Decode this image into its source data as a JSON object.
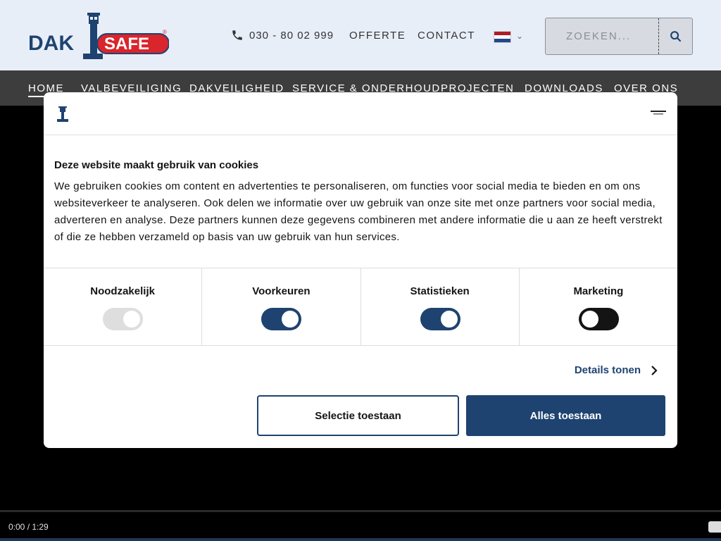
{
  "header": {
    "logo_text_left": "DAK",
    "logo_text_right": "SAFE",
    "logo_mark": "®",
    "phone": "030 - 80 02 999",
    "links": [
      "OFFERTE",
      "CONTACT"
    ],
    "search_placeholder": "ZOEKEN..."
  },
  "nav": {
    "items": [
      "HOME",
      "VALBEVEILIGING",
      "DAKVEILIGHEID",
      "SERVICE & ONDERHOUD",
      "PROJECTEN",
      "DOWNLOADS",
      "OVER ONS"
    ],
    "active": "HOME"
  },
  "cookie": {
    "title": "Deze website maakt gebruik van cookies",
    "text": "We gebruiken cookies om content en advertenties te personaliseren, om functies voor social media te bieden en om ons websiteverkeer te analyseren. Ook delen we informatie over uw gebruik van onze site met onze partners voor social media, adverteren en analyse. Deze partners kunnen deze gegevens combineren met andere informatie die u aan ze heeft verstrekt of die ze hebben verzameld op basis van uw gebruik van hun services.",
    "toggles": [
      {
        "label": "Noodzakelijk",
        "state": "on",
        "disabled": true
      },
      {
        "label": "Voorkeuren",
        "state": "on",
        "disabled": false
      },
      {
        "label": "Statistieken",
        "state": "on",
        "disabled": false
      },
      {
        "label": "Marketing",
        "state": "off",
        "disabled": false
      }
    ],
    "details_label": "Details tonen",
    "btn_selection": "Selectie toestaan",
    "btn_all": "Alles toestaan"
  },
  "video": {
    "time": "0:00 / 1:29"
  },
  "colors": {
    "brand_blue": "#1f4370",
    "brand_red": "#d9252c",
    "nav_bg": "#3d3d3d",
    "header_bg": "#e8eef8"
  }
}
